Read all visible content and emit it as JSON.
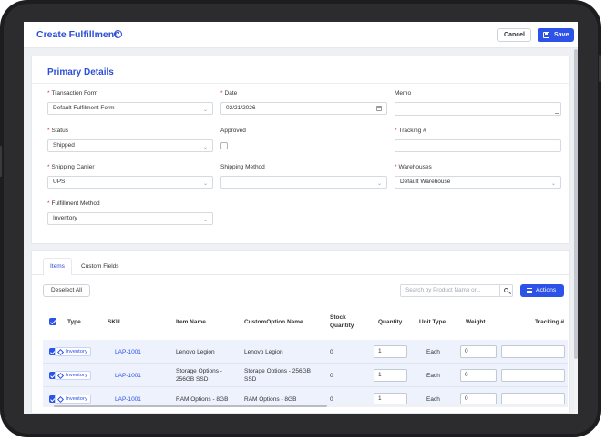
{
  "header": {
    "title": "Create Fulfillment",
    "info_icon": "info-circle-icon",
    "cancel_label": "Cancel",
    "save_label": "Save",
    "save_icon": "floppy-disk-icon"
  },
  "primary": {
    "title": "Primary Details",
    "transaction_form": {
      "label": "Transaction Form",
      "required": true,
      "value": "Default Fulfilment Form"
    },
    "date": {
      "label": "Date",
      "required": true,
      "value": "02/21/2026"
    },
    "memo": {
      "label": "Memo",
      "required": false,
      "value": ""
    },
    "status": {
      "label": "Status",
      "required": true,
      "value": "Shipped"
    },
    "approved": {
      "label": "Approved",
      "required": false,
      "checked": false
    },
    "tracking": {
      "label": "Tracking #",
      "required": true,
      "value": ""
    },
    "shipping_carrier": {
      "label": "Shipping Carrier",
      "required": true,
      "value": "UPS"
    },
    "shipping_method": {
      "label": "Shipping Method",
      "required": false,
      "value": ""
    },
    "warehouses": {
      "label": "Warehouses",
      "required": true,
      "value": "Default Warehouse"
    },
    "fulfillment_method": {
      "label": "Fulfillment Method",
      "required": true,
      "value": "Inventory"
    }
  },
  "tabs": [
    {
      "label": "Items",
      "active": true
    },
    {
      "label": "Custom Fields",
      "active": false
    }
  ],
  "toolbar": {
    "deselect_label": "Deselect All",
    "search_placeholder": "Search by Product Name or...",
    "actions_label": "Actions"
  },
  "table": {
    "columns": [
      "Type",
      "SKU",
      "Item Name",
      "CustomOption Name",
      "Stock Quantity",
      "Quantity",
      "Unit Type",
      "Weight",
      "Tracking #"
    ],
    "rows": [
      {
        "type": "Inventory",
        "sku": "LAP-1001",
        "item_name": "Lenovo Legion",
        "option_name": "Lenovo Legion",
        "stock": "0",
        "quantity": "1",
        "unit": "Each",
        "weight": "0",
        "tracking": ""
      },
      {
        "type": "Inventory",
        "sku": "LAP-1001",
        "item_name": "Storage Options - 256GB SSD",
        "option_name": "Storage Options - 256GB SSD",
        "stock": "0",
        "quantity": "1",
        "unit": "Each",
        "weight": "0",
        "tracking": ""
      },
      {
        "type": "Inventory",
        "sku": "LAP-1001",
        "item_name": "RAM Options - 8GB",
        "option_name": "RAM Options - 8GB",
        "stock": "0",
        "quantity": "1",
        "unit": "Each",
        "weight": "0",
        "tracking": ""
      }
    ]
  },
  "colors": {
    "accent": "#2d52e8",
    "title": "#2d4fd6",
    "row_selected": "#edf2fd",
    "required": "#d33333"
  }
}
